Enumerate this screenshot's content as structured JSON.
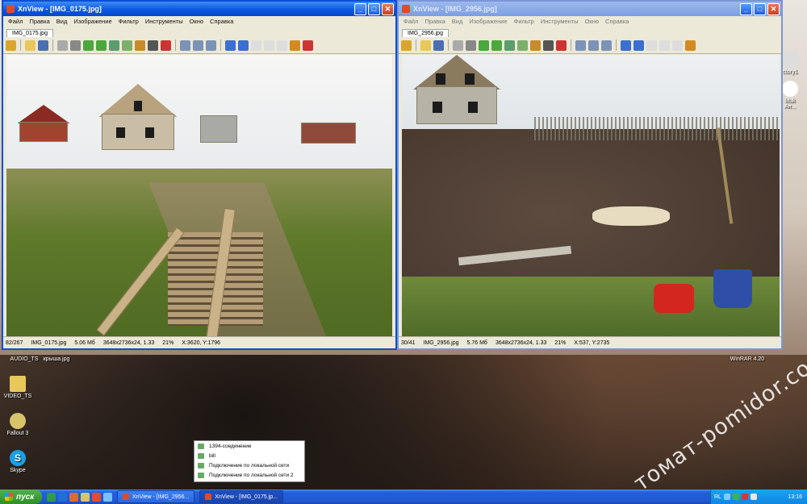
{
  "desktop": {
    "icons": [
      {
        "label": "AUDIO_TS",
        "icon": "folder-icon"
      },
      {
        "label": "крыша.jpg",
        "icon": "image-file-icon"
      },
      {
        "label": "VIDEO_TS",
        "icon": "folder-icon"
      },
      {
        "label": "Fallout 3",
        "icon": "game-icon"
      },
      {
        "label": "Skype",
        "icon": "skype-icon"
      },
      {
        "label": "WinRAR 4.20",
        "icon": "winrar-icon"
      },
      {
        "label": "ctory1",
        "icon": "file-icon"
      },
      {
        "label": "Muk",
        "icon": "file-icon"
      },
      {
        "label": "Ан...",
        "icon": "file-icon"
      }
    ],
    "watermark": "томат-pomidor.com"
  },
  "window_left": {
    "title": "XnView - [IMG_0175.jpg]",
    "menu": [
      "Файл",
      "Правка",
      "Вид",
      "Изображение",
      "Фильтр",
      "Инструменты",
      "Окно",
      "Справка"
    ],
    "tab": "IMG_0175.jpg",
    "status": {
      "index": "82/267",
      "file": "IMG_0175.jpg",
      "size": "5.06 Мб",
      "dims": "3648x2736x24, 1.33",
      "zoom": "21%",
      "coords": "X:3620, Y:1796"
    }
  },
  "window_right": {
    "title": "XnView - [IMG_2956.jpg]",
    "menu": [
      "Файл",
      "Правка",
      "Вид",
      "Изображение",
      "Фильтр",
      "Инструменты",
      "Окно",
      "Справка"
    ],
    "tab": "IMG_2956.jpg",
    "status": {
      "index": "30/41",
      "file": "IMG_2956.jpg",
      "size": "5.76 Мб",
      "dims": "3648x2736x24, 1.33",
      "zoom": "21%",
      "coords": "X:537, Y:2735"
    }
  },
  "network_popup": {
    "items": [
      "1394-соединение",
      "bill",
      "Подключение по локальной сети",
      "Подключение по локальной сети 2"
    ]
  },
  "taskbar": {
    "start_label": "пуск",
    "tasks": [
      "XnView - [IMG_2956...",
      "XnView - [IMG_0175.jp..."
    ],
    "tray_lang": "RL",
    "clock": "13:16"
  },
  "colors": {
    "title_active": "#0a55e0",
    "taskbar": "#245edb",
    "start": "#2e8f2a"
  }
}
